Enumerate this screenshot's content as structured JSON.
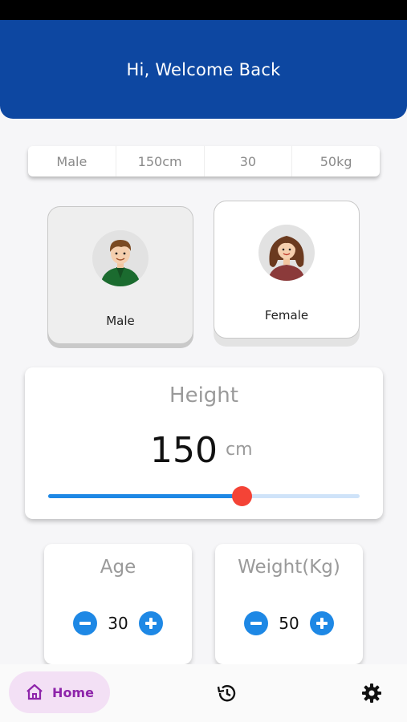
{
  "header": {
    "title": "Hi, Welcome Back"
  },
  "summary": {
    "gender": "Male",
    "height": "150cm",
    "age": "30",
    "weight": "50kg"
  },
  "gender_options": [
    {
      "label": "Male",
      "selected": true
    },
    {
      "label": "Female",
      "selected": false
    }
  ],
  "height": {
    "title": "Height",
    "value": "150",
    "unit": "cm",
    "slider_fraction": 0.62
  },
  "age": {
    "title": "Age",
    "value": "30"
  },
  "weight": {
    "title": "Weight(Kg)",
    "value": "50"
  },
  "nav": {
    "home_label": "Home",
    "active": "home",
    "icons": [
      "home-icon",
      "history-icon",
      "settings-icon"
    ]
  },
  "colors": {
    "header": "#0d47a1",
    "accent": "#1e88e5",
    "thumb": "#f44336",
    "nav_active_bg": "#f3e0f5",
    "nav_active_text": "#8e24aa"
  }
}
